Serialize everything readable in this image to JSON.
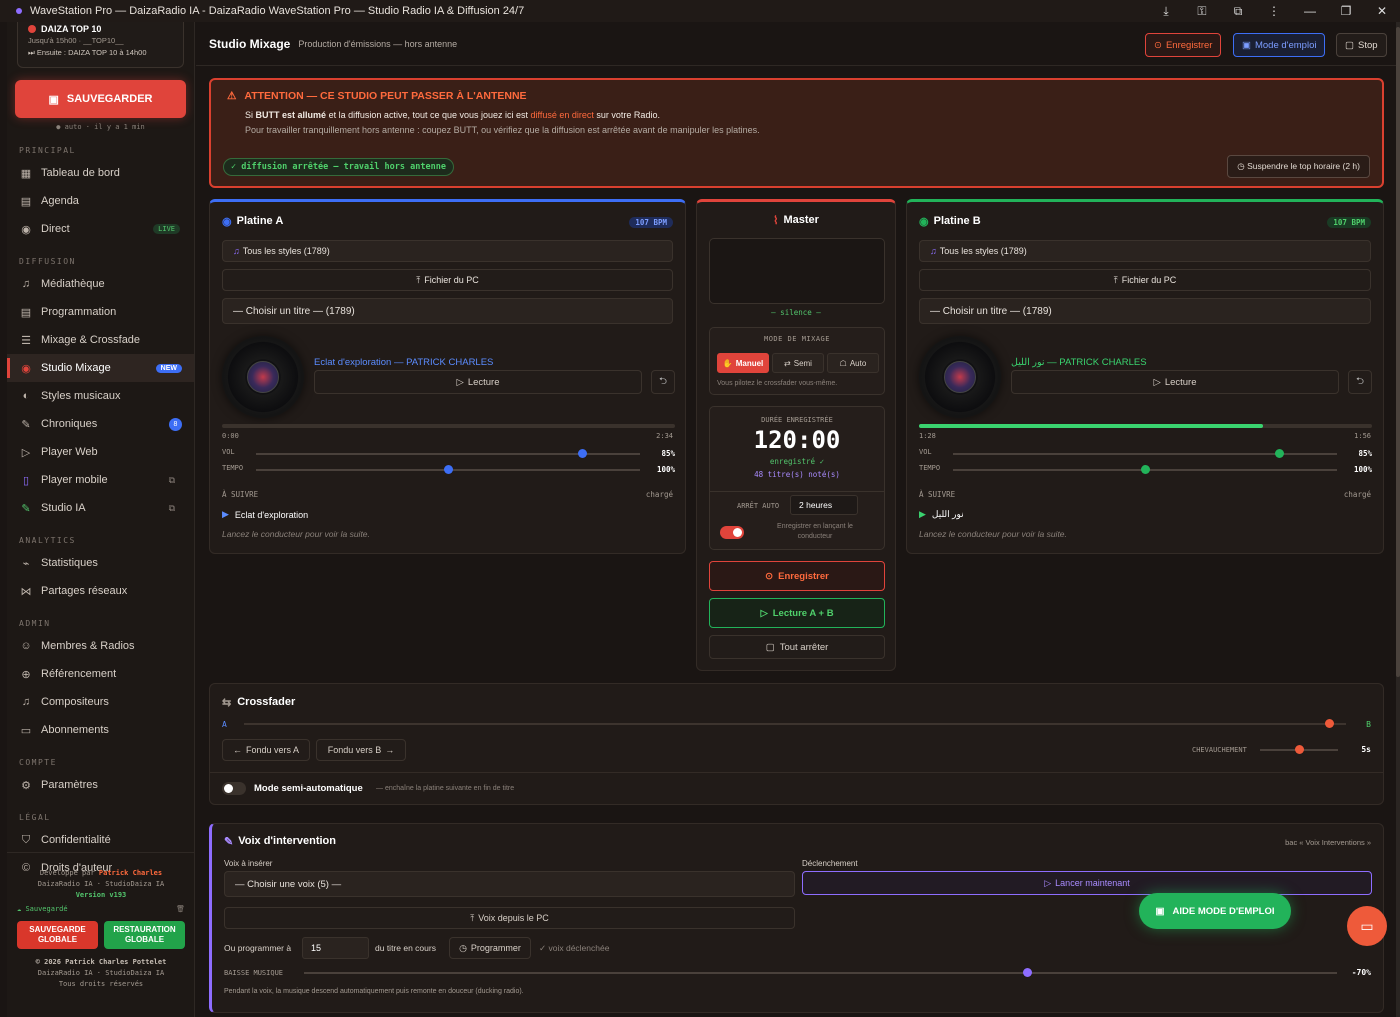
{
  "titlebar": {
    "title": "WaveStation Pro — DaizaRadio IA - DaizaRadio WaveStation Pro — Studio Radio IA & Diffusion 24/7",
    "icons": [
      "download-icon",
      "key-icon",
      "extensions-icon",
      "more-icon",
      "minimize-icon",
      "restore-icon",
      "close-icon"
    ]
  },
  "sidebar": {
    "now_playing": {
      "title": "DAIZA TOP 10",
      "line1": "Jusqu'à 15h00 · __TOP10__",
      "line2": "⏭ Ensuite : DAIZA TOP 10 à 14h00"
    },
    "save_label": "SAUVEGARDER",
    "autosave": "auto · il y a 1 min",
    "sections": {
      "principal": "PRINCIPAL",
      "diffusion": "DIFFUSION",
      "analytics": "ANALYTICS",
      "admin": "ADMIN",
      "compte": "COMPTE",
      "legal": "LÉGAL"
    },
    "items": {
      "dashboard": "Tableau de bord",
      "agenda": "Agenda",
      "direct": "Direct",
      "live": "LIVE",
      "mediatheque": "Médiathèque",
      "programmation": "Programmation",
      "mixage": "Mixage & Crossfade",
      "studio_mixage": "Studio Mixage",
      "new": "NEW",
      "styles": "Styles musicaux",
      "chroniques": "Chroniques",
      "chroniques_count": "8",
      "player_web": "Player Web",
      "player_mobile": "Player mobile",
      "studio_ia": "Studio IA",
      "stats": "Statistiques",
      "partages": "Partages réseaux",
      "membres": "Membres & Radios",
      "referencement": "Référencement",
      "compositeurs": "Compositeurs",
      "abonnements": "Abonnements",
      "parametres": "Paramètres",
      "confidentialite": "Confidentialité",
      "droits": "Droits d'auteur"
    },
    "footer": {
      "dev_prefix": "Développé par",
      "dev_name": "Patrick Charles",
      "org": "DaizaRadio IA · StudioDaiza IA",
      "version": "Version v193",
      "saved": "Sauvegardé",
      "save_global": "SAUVEGARDE GLOBALE",
      "restore_global": "RESTAURATION GLOBALE",
      "copy1": "© 2026 Patrick Charles Pottelet",
      "copy2": "DaizaRadio IA · StudioDaiza IA",
      "copy3": "Tous droits réservés"
    }
  },
  "header": {
    "title": "Studio Mixage",
    "subtitle": "Production d'émissions — hors antenne",
    "record": "Enregistrer",
    "manual": "Mode d'emploi",
    "stop": "Stop"
  },
  "alert": {
    "title": "ATTENTION — CE STUDIO PEUT PASSER À L'ANTENNE",
    "l1a": "Si",
    "l1b": "BUTT est allumé",
    "l1c": "et la diffusion active, tout ce que vous jouez ici est",
    "l1d": "diffusé en direct",
    "l1e": "sur votre Radio.",
    "l2": "Pour travailler tranquillement hors antenne : coupez BUTT, ou vérifiez que la diffusion est arrêtée avant de manipuler les platines.",
    "status": "✓ diffusion arrêtée — travail hors antenne",
    "suspend": "Suspendre le top horaire (2 h)"
  },
  "deckA": {
    "title": "Platine A",
    "bpm": "107 BPM",
    "style": "Tous les styles (1789)",
    "file": "Fichier du PC",
    "choose": "— Choisir un titre — (1789)",
    "track": "Eclat d'exploration — PATRICK CHARLES",
    "play": "Lecture",
    "time_cur": "0:00",
    "time_total": "2:34",
    "progress": 0,
    "vol_label": "VOL",
    "vol": "85%",
    "vol_value": 0.85,
    "tempo_label": "TEMPO",
    "tempo": "100%",
    "tempo_value": 0.5,
    "next_label": "À SUIVRE",
    "next_status": "chargé",
    "next_track": "Eclat d'exploration",
    "hint": "Lancez le conducteur pour voir la suite.",
    "accent": "#3d6ef5"
  },
  "deckB": {
    "title": "Platine B",
    "bpm": "107 BPM",
    "style": "Tous les styles (1789)",
    "file": "Fichier du PC",
    "choose": "— Choisir un titre — (1789)",
    "track": "نور الليل — PATRICK CHARLES",
    "play": "Lecture",
    "time_cur": "1:28",
    "time_total": "1:56",
    "progress": 0.76,
    "vol_label": "VOL",
    "vol": "85%",
    "vol_value": 0.85,
    "tempo_label": "TEMPO",
    "tempo": "100%",
    "tempo_value": 0.5,
    "next_label": "À SUIVRE",
    "next_status": "chargé",
    "next_track": "نور الليل",
    "hint": "Lancez le conducteur pour voir la suite.",
    "accent": "#22b35a"
  },
  "master": {
    "title": "Master",
    "silence": "— silence —",
    "mode_label": "MODE DE MIXAGE",
    "manuel": "Manuel",
    "semi": "Semi",
    "auto": "Auto",
    "mode_hint": "Vous pilotez le crossfader vous-même.",
    "dur_label": "DURÉE ENREGISTRÉE",
    "duration": "120:00",
    "recorded": "enregistré ✓",
    "titles": "48 titre(s) noté(s)",
    "stop_label": "ARRÊT AUTO",
    "stop_value": "2 heures",
    "rec_launch": "Enregistrer en lançant le conducteur",
    "record": "Enregistrer",
    "play_ab": "Lecture A + B",
    "stop_all": "Tout arrêter"
  },
  "crossfader": {
    "title": "Crossfader",
    "a": "A",
    "b": "B",
    "position": 0.985,
    "fade_a": "Fondu vers A",
    "fade_b": "Fondu vers B",
    "overlap_label": "CHEVAUCHEMENT",
    "overlap": "5s",
    "overlap_value": 0.5,
    "semi_label": "Mode semi-automatique",
    "semi_hint": "— enchaîne la platine suivante en fin de titre"
  },
  "voice": {
    "title": "Voix d'intervention",
    "bac": "bac « Voix Interventions »",
    "insert_label": "Voix à insérer",
    "choose": "— Choisir une voix (5) —",
    "pc": "Voix depuis le PC",
    "trigger_label": "Déclenchement",
    "launch": "Lancer maintenant",
    "schedule_label": "Ou programmer à",
    "schedule_value": "15",
    "schedule_suffix": "du titre en cours",
    "program": "Programmer",
    "triggered": "✓ voix déclenchée",
    "duck_label": "BAISSE MUSIQUE",
    "duck": "-70%",
    "duck_value": 0.7,
    "duck_hint": "Pendant la voix, la musique descend automatiquement puis remonte en douceur (ducking radio)."
  },
  "aide": "AIDE MODE D'EMPLOI",
  "colors": {
    "accent": "#e0443b",
    "blue": "#3d6ef5",
    "green": "#22b35a",
    "purple": "#8e6dff"
  }
}
